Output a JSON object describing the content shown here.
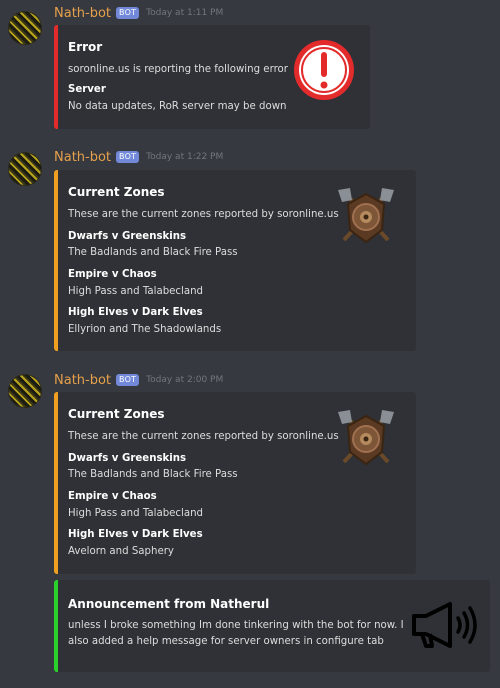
{
  "messages": [
    {
      "username": "Nath-bot",
      "bot_tag": "BOT",
      "timestamp": "Today at 1:11 PM",
      "embed": {
        "color": "#e32b2b",
        "title": "Error",
        "description": "soronline.us is reporting the following error",
        "fields": [
          {
            "name": "Server",
            "value": "No data updates, RoR server may be down"
          }
        ],
        "thumbnail": "exclamation-icon"
      }
    },
    {
      "username": "Nath-bot",
      "bot_tag": "BOT",
      "timestamp": "Today at 1:22 PM",
      "embed": {
        "color": "#f0a020",
        "title": "Current Zones",
        "description": "These are the current zones reported by soronline.us",
        "fields": [
          {
            "name": "Dwarfs v Greenskins",
            "value": "The Badlands and Black Fire Pass"
          },
          {
            "name": "Empire v Chaos",
            "value": "High Pass and Talabecland"
          },
          {
            "name": "High Elves v Dark Elves",
            "value": "Ellyrion and The Shadowlands"
          }
        ],
        "thumbnail": "crossed-axes-shield-icon"
      }
    },
    {
      "username": "Nath-bot",
      "bot_tag": "BOT",
      "timestamp": "Today at 2:00 PM",
      "embed": {
        "color": "#f0a020",
        "title": "Current Zones",
        "description": "These are the current zones reported by soronline.us",
        "fields": [
          {
            "name": "Dwarfs v Greenskins",
            "value": "The Badlands and Black Fire Pass"
          },
          {
            "name": "Empire v Chaos",
            "value": "High Pass and Talabecland"
          },
          {
            "name": "High Elves v Dark Elves",
            "value": "Avelorn and Saphery"
          }
        ],
        "thumbnail": "crossed-axes-shield-icon"
      },
      "embed2": {
        "color": "#2bd12b",
        "title": "Announcement from Natherul",
        "description_lines": [
          "unless I broke something Im done tinkering with the bot for now. I",
          "also added a help message for server owners in configure tab"
        ],
        "thumbnail": "megaphone-icon"
      }
    }
  ]
}
